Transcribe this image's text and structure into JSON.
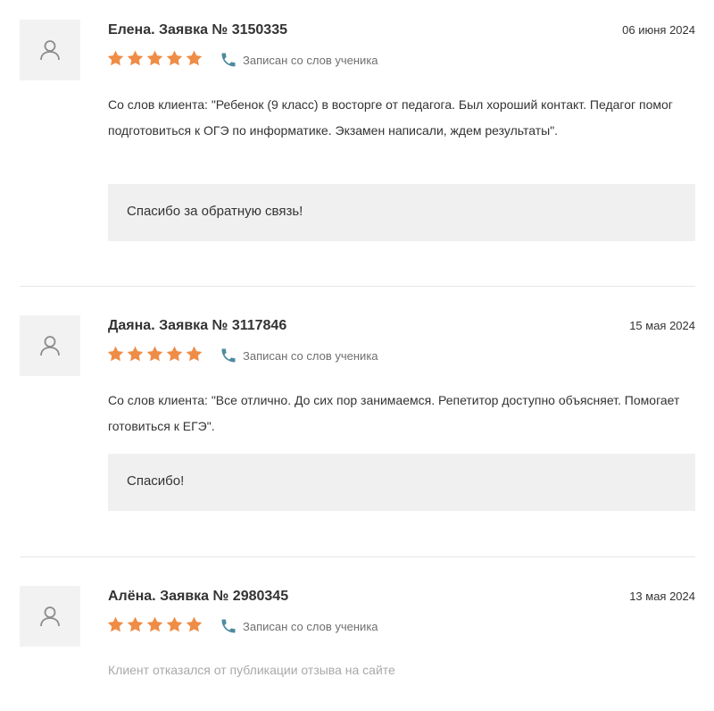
{
  "colors": {
    "star": "#ef8c45",
    "phone_icon": "#4f8aa0",
    "reply_bg": "#f0f0f0",
    "avatar_bg": "#f2f2f2"
  },
  "reviews": [
    {
      "title": "Елена. Заявка № 3150335",
      "date": "06 июня 2024",
      "rating": 5,
      "source_label": "Записан со слов ученика",
      "text": "Со слов клиента: \"Ребенок (9 класс) в восторге от педагога. Был хороший контакт. Педагог помог подготовиться к ОГЭ по информатике. Экзамен написали, ждем результаты\".",
      "reply": "Спасибо за обратную связь!"
    },
    {
      "title": "Даяна. Заявка № 3117846",
      "date": "15 мая 2024",
      "rating": 5,
      "source_label": "Записан со слов ученика",
      "text": "Со слов клиента: \"Все отлично. До сих пор занимаемся. Репетитор доступно объясняет. Помогает готовиться к ЕГЭ\".",
      "reply": "Спасибо!"
    },
    {
      "title": "Алёна. Заявка № 2980345",
      "date": "13 мая 2024",
      "rating": 5,
      "source_label": "Записан со слов ученика",
      "note": "Клиент отказался от публикации отзыва на сайте"
    }
  ]
}
